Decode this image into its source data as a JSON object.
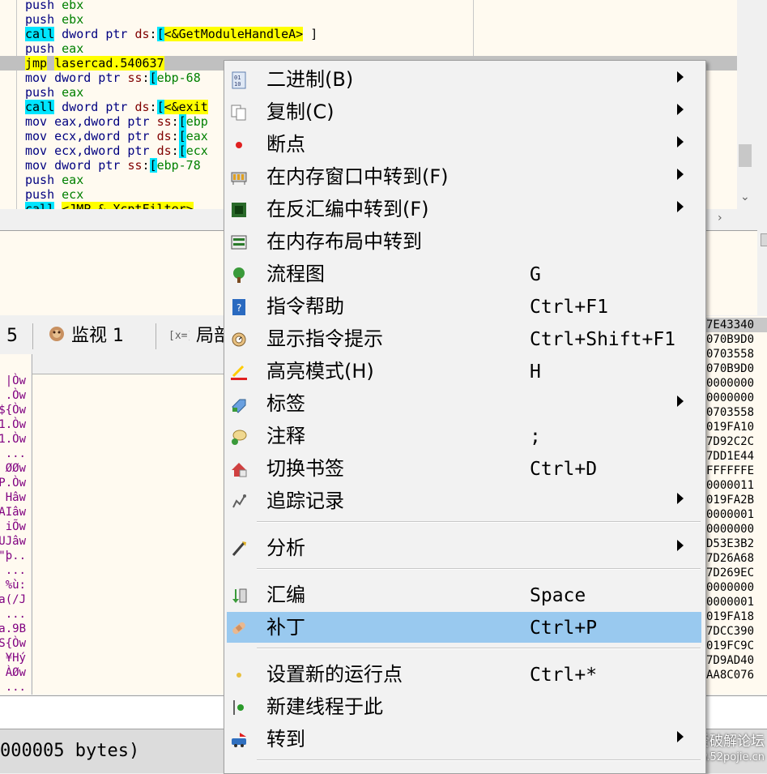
{
  "disasm": {
    "lines": [
      {
        "mn": "push",
        "args": "ebx"
      },
      {
        "mn": "push",
        "args": "ebx"
      },
      {
        "mn": "call",
        "a1": "dword ptr ",
        "seg": "ds",
        "a2": ":[",
        "hl": "<&GetModuleHandleA>",
        "a3": " ]"
      },
      {
        "mn": "push",
        "args": "eax"
      },
      {
        "mn": "jmp",
        "hl": "lasercad.540637"
      },
      {
        "mn": "mov",
        "a1": "dword ptr ",
        "seg": "ss",
        "a2": ":[",
        "reg": "ebp-68"
      },
      {
        "mn": "push",
        "args": "eax"
      },
      {
        "mn": "call",
        "a1": "dword ptr ",
        "seg": "ds",
        "a2": ":[",
        "hl": "<&exit"
      },
      {
        "mn": "mov",
        "a1": "eax,dword ptr ",
        "seg": "ss",
        "a2": ":[",
        "reg": "ebp"
      },
      {
        "mn": "mov",
        "a1": "ecx,dword ptr ",
        "seg": "ds",
        "a2": ":[",
        "reg": "eax"
      },
      {
        "mn": "mov",
        "a1": "ecx,dword ptr ",
        "seg": "ds",
        "a2": ":[",
        "reg": "ecx"
      },
      {
        "mn": "mov",
        "a1": "dword ptr ",
        "seg": "ss",
        "a2": ":[",
        "reg": "ebp-78"
      },
      {
        "mn": "push",
        "args": "eax"
      },
      {
        "mn": "push",
        "args": "ecx"
      },
      {
        "mn": "call",
        "hl": "<JMP.&_XcptFilter>"
      }
    ]
  },
  "tabs": {
    "partial_label": "5",
    "watch_label": "监视 1",
    "locals_label": "局部"
  },
  "dump_left": [
    "|Òw",
    ".Òw",
    "${Òw",
    "1.Òw",
    "1.Òw",
    "...",
    "ØØw",
    "P.Òw",
    "Hâw",
    "AIâw",
    "iÕw",
    "UJâw",
    "\"þ..",
    "...",
    "%ù:",
    "a(/J",
    "...",
    "a.9B",
    "S{Òw",
    "¥Hý",
    "ÀØw",
    "..."
  ],
  "stack_col": [
    "7E43340",
    "070B9D0",
    "0703558",
    "070B9D0",
    "0000000",
    "0000000",
    "0703558",
    "019FA10",
    "7D92C2C",
    "7DD1E44",
    "FFFFFFE",
    "0000011",
    "019FA2B",
    "0000001",
    "0000000",
    "D53E3B2",
    "7D26A68",
    "7D269EC",
    "0000000",
    "0000001",
    "019FA18",
    "7DCC390",
    "019FC9C",
    "7D9AD40",
    "AA8C076"
  ],
  "status_text": "000005 bytes)",
  "watermark": {
    "main": "吾爱破解论坛",
    "url": "www.52pojie.cn"
  },
  "menu": {
    "items": [
      {
        "label": "二进制(B)",
        "shortcut": "",
        "submenu": true,
        "icon": "binary-icon"
      },
      {
        "label": "复制(C)",
        "shortcut": "",
        "submenu": true,
        "icon": "copy-icon"
      },
      {
        "label": "断点",
        "shortcut": "",
        "submenu": true,
        "icon": "breakpoint-icon"
      },
      {
        "label": "在内存窗口中转到(F)",
        "shortcut": "",
        "submenu": true,
        "icon": "memory-window-icon"
      },
      {
        "label": "在反汇编中转到(F)",
        "shortcut": "",
        "submenu": true,
        "icon": "disassembly-icon"
      },
      {
        "label": "在内存布局中转到",
        "shortcut": "",
        "submenu": false,
        "icon": "memory-map-icon"
      },
      {
        "label": "流程图",
        "shortcut": "G",
        "submenu": false,
        "icon": "graph-icon"
      },
      {
        "label": "指令帮助",
        "shortcut": "Ctrl+F1",
        "submenu": false,
        "icon": "help-icon"
      },
      {
        "label": "显示指令提示",
        "shortcut": "Ctrl+Shift+F1",
        "submenu": false,
        "icon": "tooltip-icon"
      },
      {
        "label": "高亮模式(H)",
        "shortcut": "H",
        "submenu": false,
        "icon": "highlight-icon"
      },
      {
        "label": "标签",
        "shortcut": "",
        "submenu": true,
        "icon": "label-icon"
      },
      {
        "label": "注释",
        "shortcut": ";",
        "submenu": false,
        "icon": "comment-icon"
      },
      {
        "label": "切换书签",
        "shortcut": "Ctrl+D",
        "submenu": false,
        "icon": "bookmark-icon"
      },
      {
        "label": "追踪记录",
        "shortcut": "",
        "submenu": true,
        "icon": "trace-icon"
      },
      {
        "label": "分析",
        "shortcut": "",
        "submenu": true,
        "icon": "analysis-icon"
      },
      {
        "label": "汇编",
        "shortcut": "Space",
        "submenu": false,
        "icon": "assemble-icon"
      },
      {
        "label": "补丁",
        "shortcut": "Ctrl+P",
        "submenu": false,
        "icon": "patch-icon",
        "highlighted": true
      },
      {
        "label": "设置新的运行点",
        "shortcut": "Ctrl+*",
        "submenu": false,
        "icon": "new-origin-icon"
      },
      {
        "label": "新建线程于此",
        "shortcut": "",
        "submenu": false,
        "icon": "new-thread-icon"
      },
      {
        "label": "转到",
        "shortcut": "",
        "submenu": true,
        "icon": "goto-icon"
      }
    ]
  }
}
